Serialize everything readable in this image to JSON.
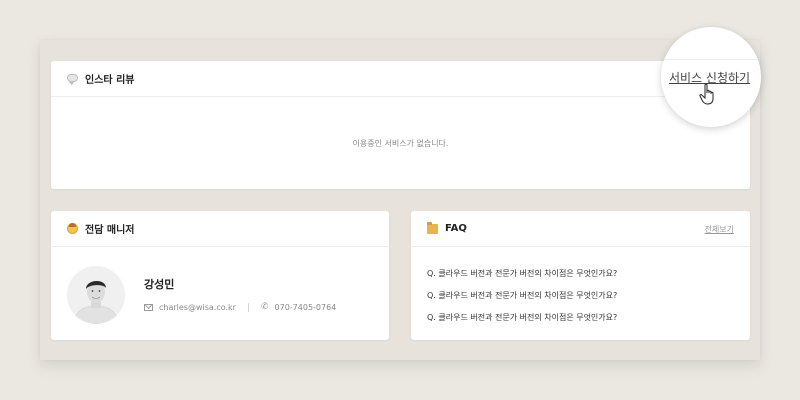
{
  "insta_review": {
    "title": "인스타 리뷰",
    "icon": "speech-bubble-icon",
    "empty_message": "이용중인 서비스가 없습니다.",
    "apply_link": "서비스 신청하기"
  },
  "manager": {
    "title": "전담 매니저",
    "icon": "face-icon",
    "name": "강성민",
    "email": "charles@wisa.co.kr",
    "phone": "070-7405-0764"
  },
  "faq": {
    "title": "FAQ",
    "icon": "folder-icon",
    "view_all": "전체보기",
    "items": [
      "Q. 클라우드 버전과 전문가 버전의 차이점은 무엇인가요?",
      "Q. 클라우드 버전과 전문가 버전의 차이점은 무엇인가요?",
      "Q. 클라우드 버전과 전문가 버전의 차이점은 무엇인가요?"
    ]
  },
  "colors": {
    "background": "#ebe8e2",
    "card": "#ffffff",
    "accent_icon": "#f6c34a"
  }
}
